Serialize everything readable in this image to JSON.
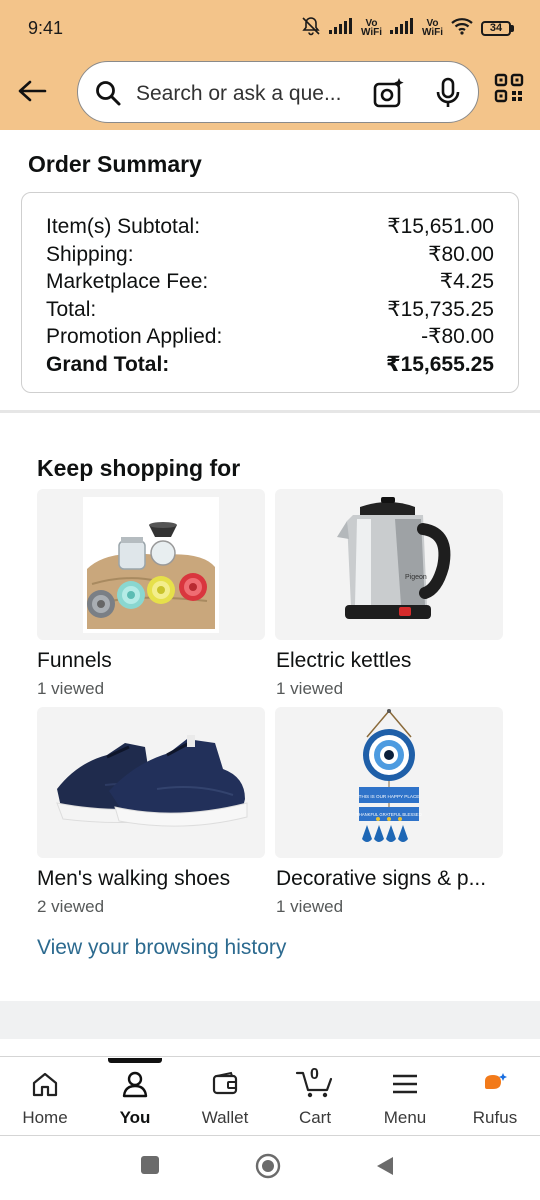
{
  "status": {
    "time": "9:41",
    "battery": "34",
    "vowifi_top": "Vo",
    "vowifi_bottom": "WiFi"
  },
  "search": {
    "placeholder": "Search or ask a que..."
  },
  "order_summary": {
    "title": "Order Summary",
    "rows": [
      {
        "label": "Item(s) Subtotal:",
        "value": "₹15,651.00"
      },
      {
        "label": "Shipping:",
        "value": "₹80.00"
      },
      {
        "label": "Marketplace Fee:",
        "value": "₹4.25"
      },
      {
        "label": "Total:",
        "value": "₹15,735.25"
      },
      {
        "label": "Promotion Applied:",
        "value": "-₹80.00"
      }
    ],
    "grand_total": {
      "label": "Grand Total:",
      "value": "₹15,655.25"
    }
  },
  "keep_shopping": {
    "title": "Keep shopping for",
    "items": [
      {
        "label": "Funnels",
        "sub": "1 viewed"
      },
      {
        "label": "Electric kettles",
        "sub": "1 viewed"
      },
      {
        "label": "Men's walking shoes",
        "sub": "2 viewed"
      },
      {
        "label": "Decorative signs & p...",
        "sub": "1 viewed"
      }
    ],
    "history_link": "View your browsing history",
    "kettle_brand": "Pigeon",
    "sign_line1": "THIS IS OUR HAPPY PLACE",
    "sign_line2": "THANKFUL GRATEFUL BLESSED"
  },
  "bottom_nav": {
    "items": [
      {
        "label": "Home"
      },
      {
        "label": "You"
      },
      {
        "label": "Wallet"
      },
      {
        "label": "Cart"
      },
      {
        "label": "Menu"
      },
      {
        "label": "Rufus"
      }
    ],
    "cart_count": "0",
    "active": "You"
  },
  "colors": {
    "header_bg": "#f3c48a",
    "link": "#2c6a8f",
    "tile_bg": "#f3f3f3"
  }
}
